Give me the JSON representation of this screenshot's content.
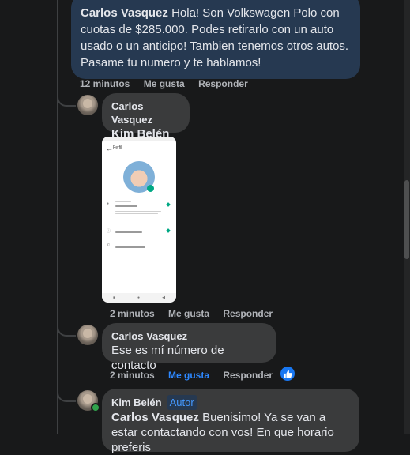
{
  "comments": [
    {
      "author": "Carlos Vasquez",
      "text": "Hola! Son Volkswagen Polo con cuotas de $285.000. Podes retirarlo con un auto usado o un anticipo! Tambien tenemos otros autos. Pasame tu numero y te hablamos!",
      "time": "12 minutos",
      "like_label": "Me gusta",
      "reply_label": "Responder",
      "highlighted": true
    },
    {
      "author": "Carlos Vasquez",
      "text": "Kim Belén",
      "time": "2 minutos",
      "like_label": "Me gusta",
      "reply_label": "Responder",
      "attachment": {
        "type": "screenshot",
        "header": "Perfil",
        "nav_icons": [
          "■",
          "●",
          "◀"
        ]
      }
    },
    {
      "author": "Carlos Vasquez",
      "text": "Ese es mí número de contacto",
      "time": "2 minutos",
      "like_label": "Me gusta",
      "reply_label": "Responder",
      "liked": true,
      "reaction_icon": "thumbs-up-icon"
    },
    {
      "author": "Kim Belén",
      "badge": "Autor",
      "mention": "Carlos Vasquez",
      "text": "Buenisimo! Ya se van a estar contactando con vos! En que horario preferis"
    }
  ],
  "colors": {
    "background": "#18191a",
    "bubble": "#3a3b3c",
    "highlight_bubble": "#263951",
    "link_blue": "#2d88ff",
    "online_green": "#31a24c"
  }
}
